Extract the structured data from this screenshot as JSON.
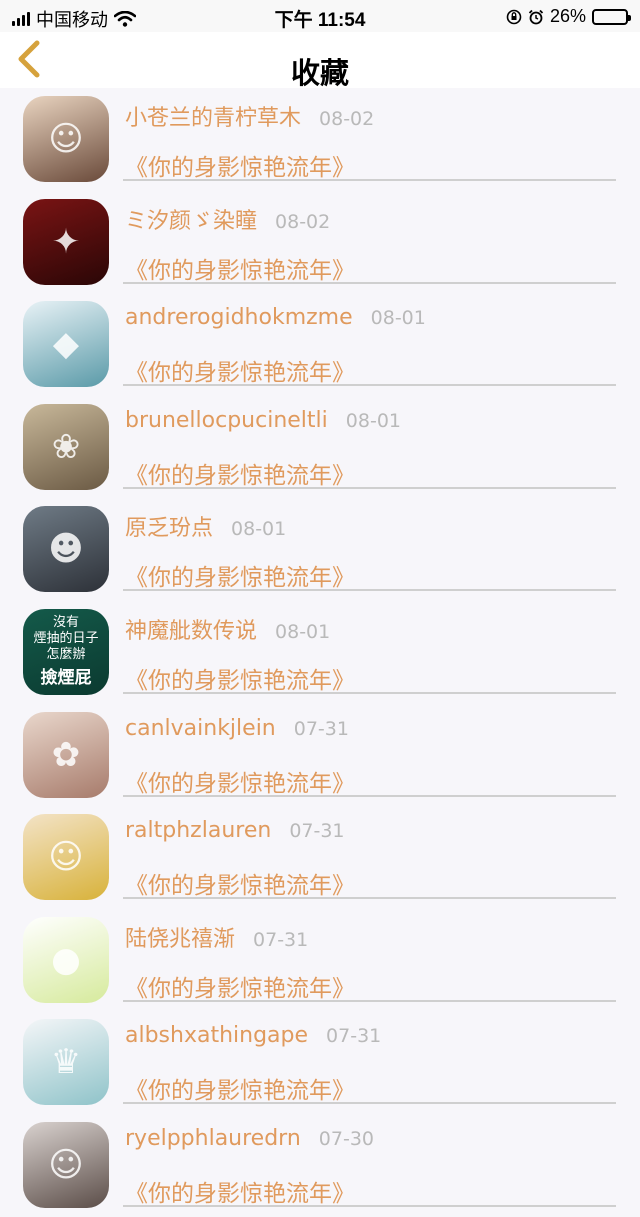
{
  "status_bar": {
    "carrier": "中国移动",
    "time": "下午 11:54",
    "battery": "26%",
    "battery_level": 0.26
  },
  "nav": {
    "title": "收藏"
  },
  "items": [
    {
      "user": "小苍兰的青柠草木",
      "date": "08-02",
      "work": "《你的身影惊艳流年》",
      "avatar_colors": [
        "#e9d4c0",
        "#6a4a3a"
      ],
      "avatar_glyph": "☺"
    },
    {
      "user": "ミ汐颜ゞ染瞳",
      "date": "08-02",
      "work": "《你的身影惊艳流年》",
      "avatar_colors": [
        "#7a1414",
        "#2a0606"
      ],
      "avatar_glyph": "✦"
    },
    {
      "user": "andrerogidhokmzme",
      "date": "08-01",
      "work": "《你的身影惊艳流年》",
      "avatar_colors": [
        "#e8f2f6",
        "#5a9aa8"
      ],
      "avatar_glyph": "◆"
    },
    {
      "user": "brunellocpucineltli",
      "date": "08-01",
      "work": "《你的身影惊艳流年》",
      "avatar_colors": [
        "#c8b89a",
        "#6b5a44"
      ],
      "avatar_glyph": "❀"
    },
    {
      "user": "原乏玢点",
      "date": "08-01",
      "work": "《你的身影惊艳流年》",
      "avatar_colors": [
        "#6f7b86",
        "#2d3138"
      ],
      "avatar_glyph": "☻"
    },
    {
      "user": "神魔舭数传说",
      "date": "08-01",
      "work": "《你的身影惊艳流年》",
      "avatar_colors": [
        "#145a4a",
        "#0b3a30"
      ],
      "avatar_glyph": "",
      "avatar_text": [
        "沒有",
        "煙抽的日子",
        "怎麼辦",
        "撿煙屁"
      ]
    },
    {
      "user": "canlvainkjlein",
      "date": "07-31",
      "work": "《你的身影惊艳流年》",
      "avatar_colors": [
        "#e9d7cc",
        "#a77b6b"
      ],
      "avatar_glyph": "✿"
    },
    {
      "user": "raltphzlauren",
      "date": "07-31",
      "work": "《你的身影惊艳流年》",
      "avatar_colors": [
        "#f3e3c7",
        "#d8b23a"
      ],
      "avatar_glyph": "☺"
    },
    {
      "user": "陆侥兆禧渐",
      "date": "07-31",
      "work": "《你的身影惊艳流年》",
      "avatar_colors": [
        "#ffffff",
        "#d6ea9c"
      ],
      "avatar_glyph": "●"
    },
    {
      "user": "albshxathingape",
      "date": "07-31",
      "work": "《你的身影惊艳流年》",
      "avatar_colors": [
        "#f4f6f8",
        "#8fc3c9"
      ],
      "avatar_glyph": "♛"
    },
    {
      "user": "ryelpphlauredrn",
      "date": "07-30",
      "work": "《你的身影惊艳流年》",
      "avatar_colors": [
        "#d9d2cf",
        "#5b4d48"
      ],
      "avatar_glyph": "☺"
    }
  ],
  "colors": {
    "accent": "#e09a5d",
    "date": "#b9b9b9",
    "background": "#f7f6fa"
  }
}
